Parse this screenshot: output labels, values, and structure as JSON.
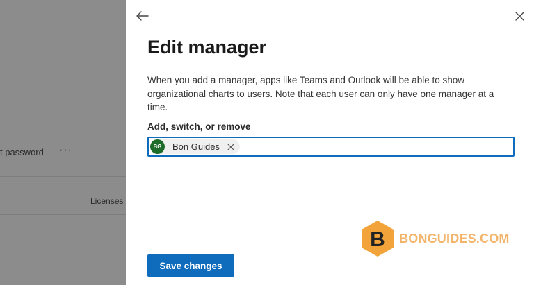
{
  "background": {
    "row_label": "t password",
    "more_label": "···",
    "column_header": "Licenses"
  },
  "panel": {
    "title": "Edit manager",
    "description": "When you add a manager, apps like Teams and Outlook will be able to show organizational charts to users. Note that each user can only have one manager at a time.",
    "field_label": "Add, switch, or remove",
    "selected_person": {
      "initials": "BG",
      "name": "Bon Guides",
      "avatar_color": "#1e6c2a"
    },
    "save_label": "Save changes",
    "accent_color": "#0f6cbd",
    "back_icon": "arrow-left-icon",
    "close_icon": "close-icon"
  },
  "watermark": {
    "letter": "B",
    "text": "BONGUIDES.COM"
  }
}
